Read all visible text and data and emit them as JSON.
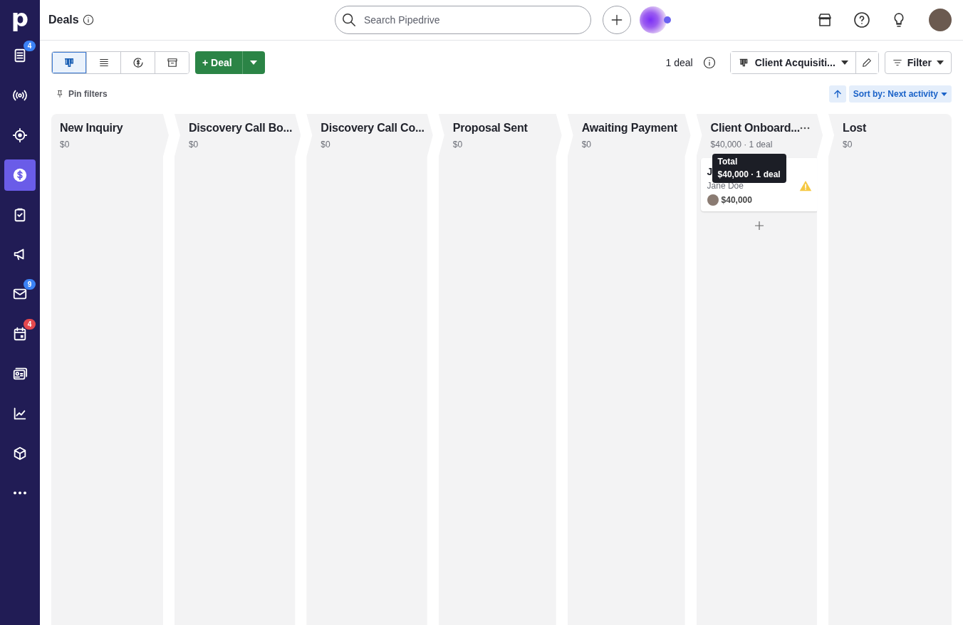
{
  "sidebar": {
    "logo": "p",
    "items": [
      {
        "kind": "leads",
        "selected": false,
        "badge": "4",
        "color": "#3b82f6"
      },
      {
        "kind": "signal",
        "selected": false
      },
      {
        "kind": "target",
        "selected": false
      },
      {
        "kind": "deals",
        "selected": true
      },
      {
        "kind": "tasks",
        "selected": false
      },
      {
        "kind": "campaigns",
        "selected": false
      },
      {
        "kind": "mail",
        "selected": false,
        "badge": "9",
        "color": "#3b82f6"
      },
      {
        "kind": "calendar",
        "selected": false,
        "badge": "4",
        "color": "#e5484d"
      },
      {
        "kind": "contacts",
        "selected": false
      },
      {
        "kind": "insights",
        "selected": false
      },
      {
        "kind": "products",
        "selected": false
      },
      {
        "kind": "more",
        "selected": false
      }
    ]
  },
  "header": {
    "title": "Deals",
    "search": {
      "placeholder": "Search Pipedrive"
    }
  },
  "toolbar": {
    "views": [
      {
        "kind": "pipeline",
        "selected": true
      },
      {
        "kind": "list",
        "selected": false
      },
      {
        "kind": "forecast",
        "selected": false
      },
      {
        "kind": "archive",
        "selected": false
      }
    ],
    "add_button": "+ Deal",
    "deal_count": "1 deal",
    "pipeline": "Client Acquisiti...",
    "filter": "Filter",
    "pin_filters": "Pin filters",
    "sort": "Sort by: Next activity"
  },
  "stages": [
    {
      "name": "New Inquiry",
      "total": "$0"
    },
    {
      "name": "Discovery Call Bo...",
      "total": "$0"
    },
    {
      "name": "Discovery Call Co...",
      "total": "$0"
    },
    {
      "name": "Proposal Sent",
      "total": "$0"
    },
    {
      "name": "Awaiting Payment",
      "total": "$0"
    },
    {
      "name": "Client Onboard...",
      "total": "$40,000 · 1 deal",
      "menu": true,
      "deals": [
        {
          "title": "J",
          "person": "Jane Doe",
          "value": "$40,000",
          "warning": true
        }
      ],
      "tooltip": {
        "title": "Total",
        "text": "$40,000 · 1 deal"
      }
    },
    {
      "name": "Lost",
      "total": "$0"
    }
  ]
}
